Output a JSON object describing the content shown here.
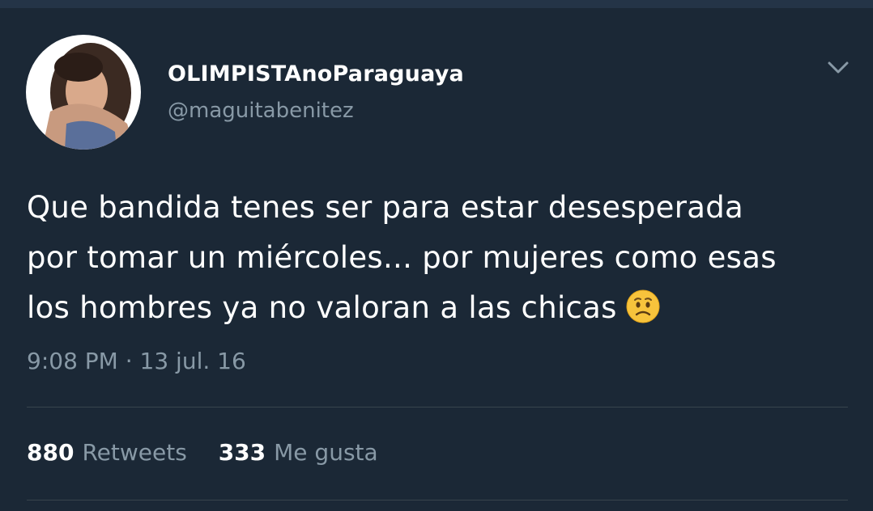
{
  "tweet": {
    "author": {
      "display_name": "OLIMPISTAnoParaguaya",
      "handle": "@maguitabenitez"
    },
    "text_lines": [
      "Que bandida tenes ser para estar desesperada",
      "por tomar un miércoles... por mujeres como esas",
      "los hombres ya no valoran a las chicas"
    ],
    "emoji": "worried-face",
    "timestamp": "9:08 PM · 13 jul. 16",
    "stats": {
      "retweets_count": "880",
      "retweets_label": "Retweets",
      "likes_count": "333",
      "likes_label": "Me gusta"
    }
  },
  "icons": {
    "menu": "chevron-down-icon",
    "emoji": "worried-face-emoji-icon"
  },
  "colors": {
    "background": "#1b2836",
    "primary_text": "#ffffff",
    "secondary_text": "#8899a6",
    "divider": "#38444d"
  }
}
